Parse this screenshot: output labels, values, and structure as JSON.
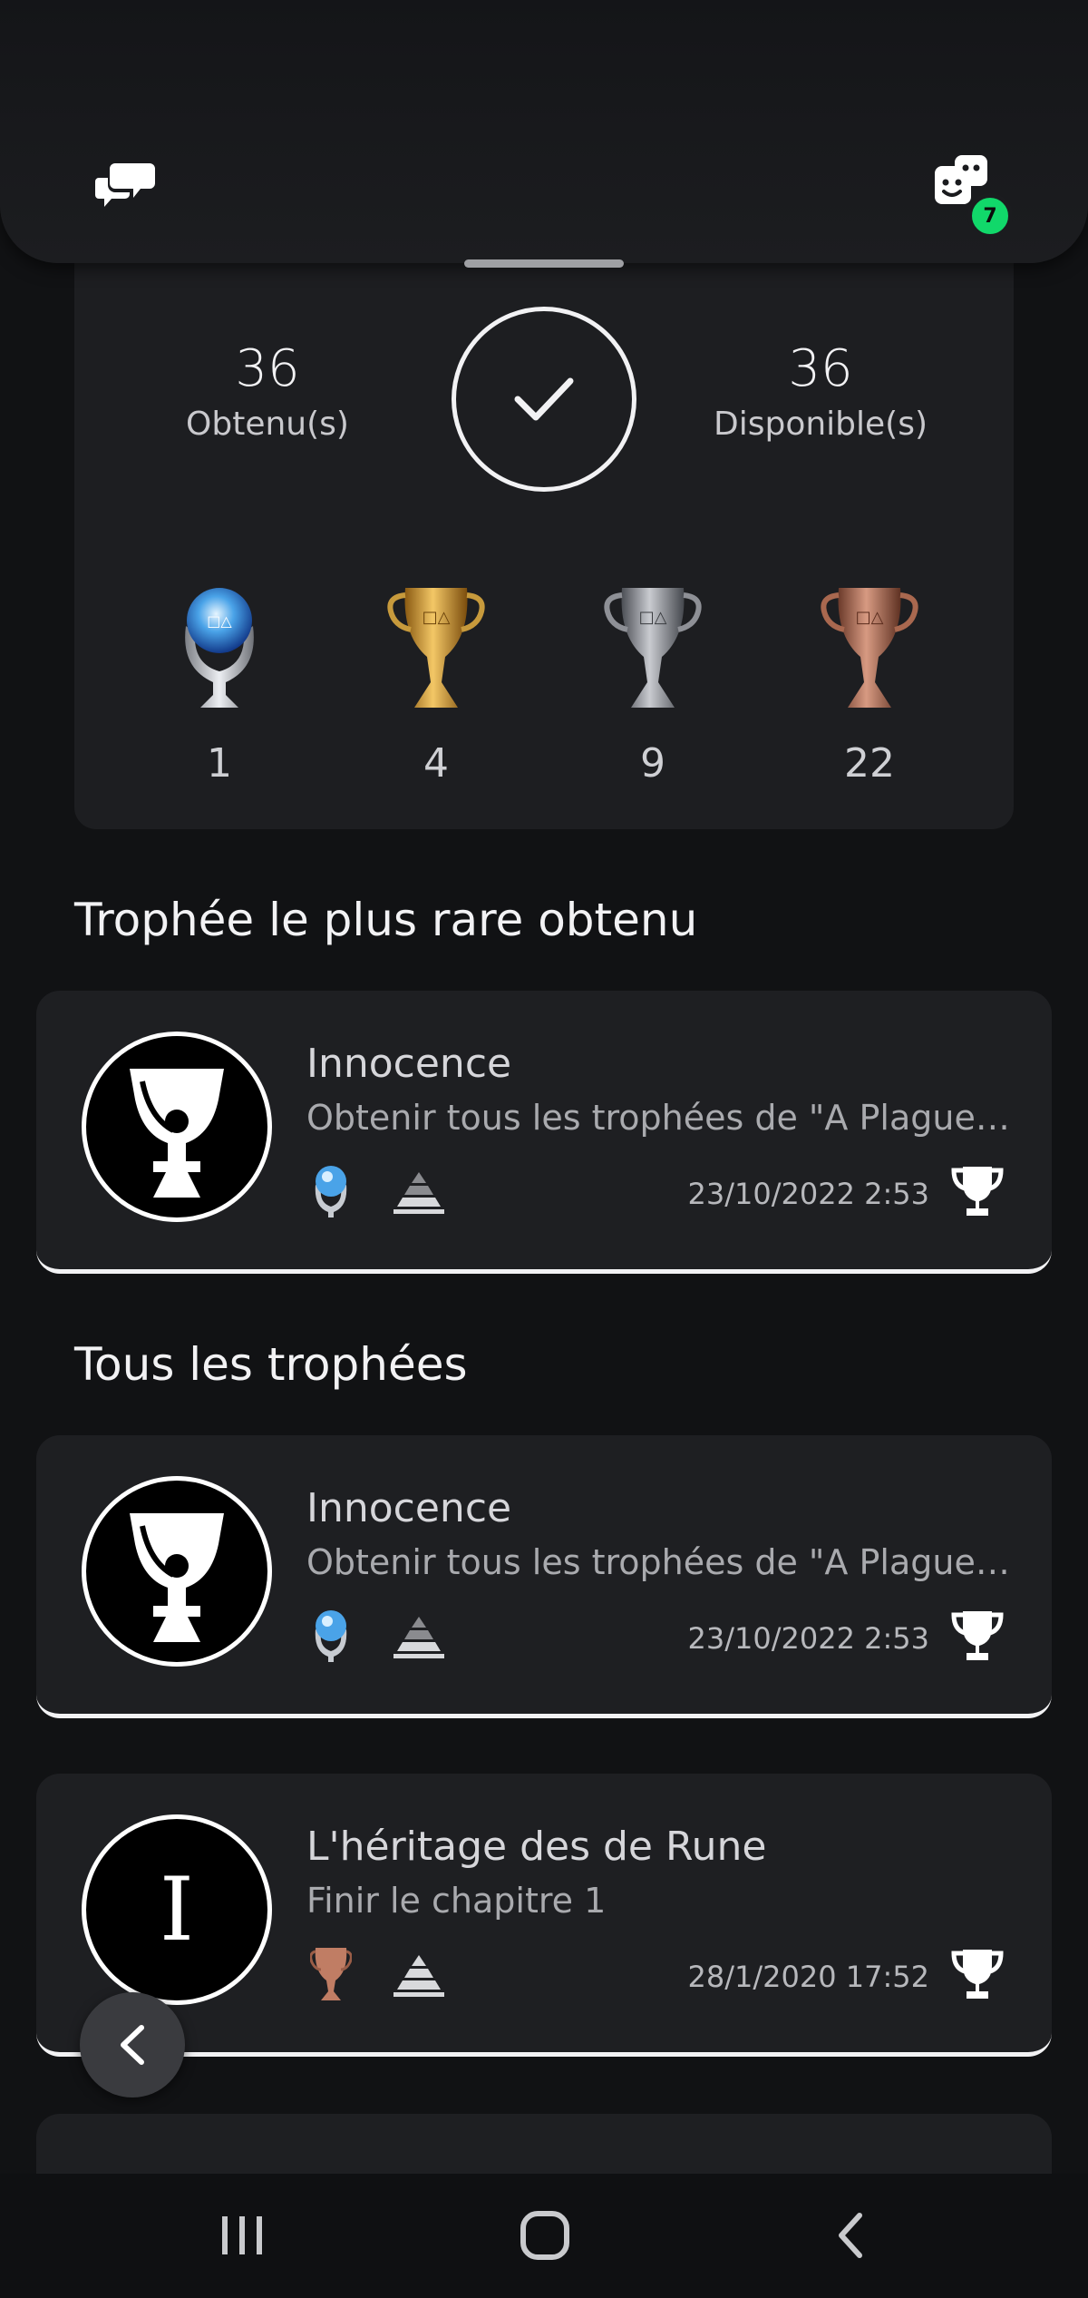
{
  "header": {
    "left_icon": "chat-bubbles-icon",
    "right_icon": "game-avatar-icon",
    "notification_count": "7",
    "accent_color": "#11d86a"
  },
  "summary": {
    "earned_count": "36",
    "earned_label": "Obtenu(s)",
    "available_count": "36",
    "available_label": "Disponible(s)",
    "status_icon": "check-icon",
    "trophies": [
      {
        "type": "platinum",
        "count": "1"
      },
      {
        "type": "gold",
        "count": "4"
      },
      {
        "type": "silver",
        "count": "9"
      },
      {
        "type": "bronze",
        "count": "22"
      }
    ]
  },
  "rarest": {
    "section_title": "Trophée le plus rare obtenu",
    "item": {
      "name": "Innocence",
      "description": "Obtenir tous les trophées de \"A Plague Tale: Innocence\"",
      "grade": "platinum",
      "date": "23/10/2022  2:53"
    }
  },
  "all": {
    "section_title": "Tous les trophées",
    "items": [
      {
        "name": "Innocence",
        "description": "Obtenir tous les trophées de \"A Plague Tale: Innocence\"",
        "grade": "platinum",
        "date": "23/10/2022  2:53"
      },
      {
        "name": "L'héritage des de Rune",
        "description": "Finir le chapitre 1",
        "grade": "bronze",
        "date": "28/1/2020  17:52",
        "art_letter": "I"
      }
    ]
  },
  "navigation": {
    "back_fab_icon": "chevron-left-icon",
    "system_buttons": [
      "recent-apps-icon",
      "home-icon",
      "back-icon"
    ]
  }
}
